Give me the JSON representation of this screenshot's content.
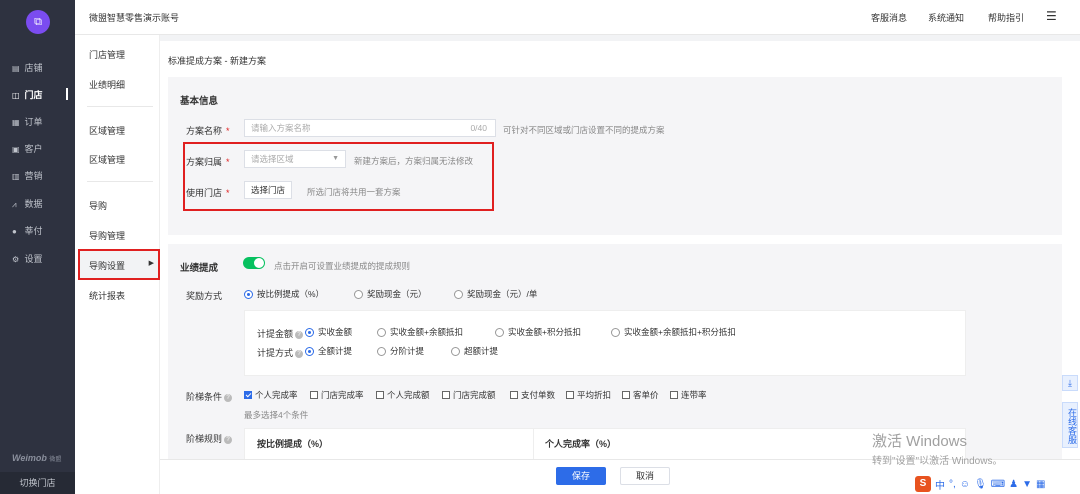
{
  "colors": {
    "accent": "#2d6ce8",
    "toggle_on": "#07c160",
    "highlight": "#e02020",
    "nav_bg": "#2e3240"
  },
  "nav": {
    "items": [
      {
        "label": "店铺",
        "icon": "store-icon"
      },
      {
        "label": "门店",
        "icon": "shop-icon"
      },
      {
        "label": "订单",
        "icon": "order-icon"
      },
      {
        "label": "客户",
        "icon": "customer-icon"
      },
      {
        "label": "营销",
        "icon": "marketing-icon"
      },
      {
        "label": "数据",
        "icon": "data-icon"
      },
      {
        "label": "莘付",
        "icon": "pay-icon"
      },
      {
        "label": "设置",
        "icon": "settings-icon"
      }
    ],
    "brand": "Weimob",
    "brand_sub": "微盟",
    "switch_store": "切换门店"
  },
  "topbar": {
    "account": "微盟智慧零售演示账号",
    "links": [
      "客服消息",
      "系统通知",
      "帮助指引"
    ]
  },
  "subnav": {
    "items": [
      "门店管理",
      "业绩明细",
      "区域管理",
      "区域管理",
      "导购",
      "导购管理",
      "导购设置",
      "统计报表"
    ]
  },
  "breadcrumb": "标准提成方案 - 新建方案",
  "basic": {
    "title": "基本信息",
    "name_label": "方案名称",
    "name_placeholder": "请输入方案名称",
    "name_count": "0/40",
    "name_hint": "可针对不同区域或门店设置不同的提成方案",
    "region_label": "方案归属",
    "region_placeholder": "请选择区域",
    "region_hint": "新建方案后，方案归属无法修改",
    "store_label": "使用门店",
    "store_button": "选择门店",
    "store_hint": "所选门店将共用一套方案"
  },
  "perf": {
    "title": "业绩提成",
    "toggle_hint": "点击开启可设置业绩提成的提成规则",
    "toggle_on": true,
    "reward_label": "奖励方式",
    "reward_options": [
      "按比例提成（%）",
      "奖励现金（元）",
      "奖励现金（元）/单"
    ],
    "calc_amount_label": "计提金额",
    "calc_amount_options": [
      "实收金额",
      "实收金额+余额抵扣",
      "实收金额+积分抵扣",
      "实收金额+余额抵扣+积分抵扣"
    ],
    "calc_method_label": "计提方式",
    "calc_method_options": [
      "全额计提",
      "分阶计提",
      "超额计提"
    ],
    "ladder_label": "阶梯条件",
    "ladder_options": [
      "个人完成率",
      "门店完成率",
      "个人完成额",
      "门店完成额",
      "支付单数",
      "平均折扣",
      "客单价",
      "连带率"
    ],
    "ladder_note": "最多选择4个条件",
    "rule_label": "阶梯规则",
    "table_headers": [
      "按比例提成（%）",
      "个人完成率（%）"
    ]
  },
  "footer": {
    "save": "保存",
    "cancel": "取消"
  },
  "watermark": {
    "line1": "激活 Windows",
    "line2": "转到\"设置\"以激活 Windows。"
  },
  "side_tools": {
    "service": "在线客服"
  },
  "tray": {
    "ime": "中"
  }
}
